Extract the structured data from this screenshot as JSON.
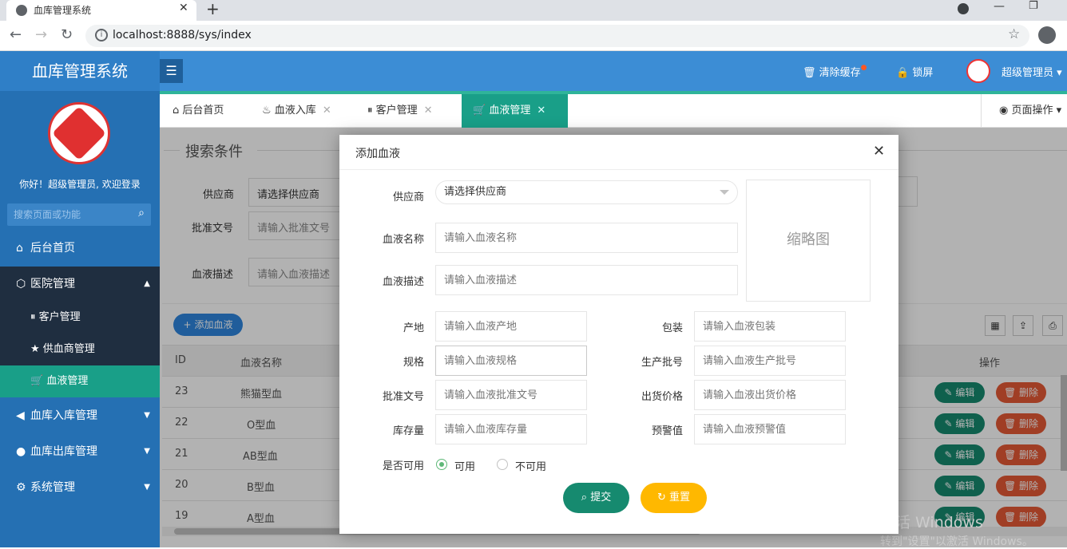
{
  "browser": {
    "tab_title": "血库管理系统",
    "tab_close": "✕",
    "new_tab": "+",
    "url": "localhost:8888/sys/index",
    "win_min": "—",
    "win_max": "❐"
  },
  "header": {
    "app_name": "血库管理系统",
    "menu_icon": "☰",
    "clear_cache": "清除缓存",
    "lock": "锁屏",
    "user": "超级管理员"
  },
  "sidebar": {
    "welcome": "你好！超级管理员, 欢迎登录",
    "search_placeholder": "搜索页面或功能",
    "items": [
      {
        "label": "后台首页",
        "icon": "home-icon"
      },
      {
        "label": "医院管理",
        "icon": "cube-icon",
        "expanded": true
      },
      {
        "label": "客户管理",
        "icon": "pause-circle-icon"
      },
      {
        "label": "供血商管理",
        "icon": "star-icon"
      },
      {
        "label": "血液管理",
        "icon": "cart-icon",
        "active": true
      },
      {
        "label": "血库入库管理",
        "icon": "volume-icon"
      },
      {
        "label": "血库出库管理",
        "icon": "chat-icon"
      },
      {
        "label": "系统管理",
        "icon": "gear-icon"
      }
    ]
  },
  "tabs": [
    {
      "label": "后台首页",
      "icon": "home-icon"
    },
    {
      "label": "血液入库",
      "icon": "fire-icon",
      "close": "✕"
    },
    {
      "label": "客户管理",
      "icon": "pause-circle-icon",
      "close": "✕"
    },
    {
      "label": "血液管理",
      "icon": "cart-icon",
      "close": "✕",
      "active": true
    }
  ],
  "page_ops": "页面操作",
  "search": {
    "legend": "搜索条件",
    "supplier_label": "供应商",
    "supplier_value": "请选择供应商",
    "approval_label": "批准文号",
    "approval_placeholder": "请输入批准文号",
    "desc_label": "血液描述",
    "desc_placeholder": "请输入血液描述"
  },
  "add_button": "添加血液",
  "table": {
    "headers": [
      "ID",
      "血液名称",
      "操作"
    ],
    "edit_label": "编辑",
    "delete_label": "删除",
    "rows": [
      {
        "id": "23",
        "name": "熊猫型血"
      },
      {
        "id": "22",
        "name": "O型血"
      },
      {
        "id": "21",
        "name": "AB型血"
      },
      {
        "id": "20",
        "name": "B型血"
      },
      {
        "id": "19",
        "name": "A型血"
      }
    ]
  },
  "watermark": {
    "line1": "激活 Windows",
    "line2": "转到\"设置\"以激活 Windows。"
  },
  "dialog": {
    "title": "添加血液",
    "close": "✕",
    "supplier_label": "供应商",
    "supplier_value": "请选择供应商",
    "thumbnail": "缩略图",
    "name_label": "血液名称",
    "name_placeholder": "请输入血液名称",
    "desc_label": "血液描述",
    "desc_placeholder": "请输入血液描述",
    "origin_label": "产地",
    "origin_placeholder": "请输入血液产地",
    "pack_label": "包装",
    "pack_placeholder": "请输入血液包装",
    "spec_label": "规格",
    "spec_placeholder": "请输入血液规格",
    "batch_label": "生产批号",
    "batch_placeholder": "请输入血液生产批号",
    "approval_label": "批准文号",
    "approval_placeholder": "请输入血液批准文号",
    "price_label": "出货价格",
    "price_placeholder": "请输入血液出货价格",
    "stock_label": "库存量",
    "stock_placeholder": "请输入血液库存量",
    "warn_label": "预警值",
    "warn_placeholder": "请输入血液预警值",
    "available_label": "是否可用",
    "opt_yes": "可用",
    "opt_no": "不可用",
    "submit": "提交",
    "reset": "重置"
  },
  "colors": {
    "header": "#3c8dd5",
    "sidebar": "#2570b3",
    "accent": "#199f88",
    "orange": "#ffb800",
    "danger": "#e65a35"
  }
}
